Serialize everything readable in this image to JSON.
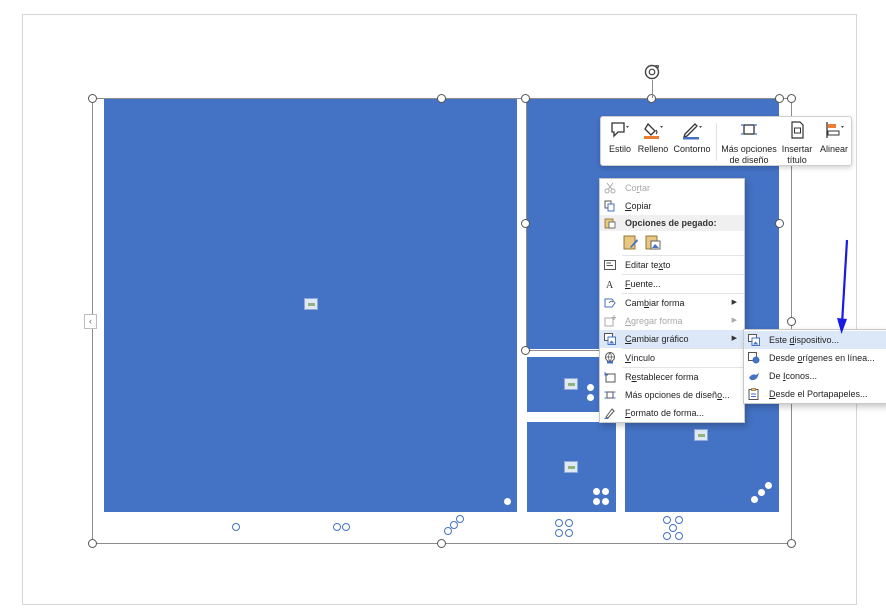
{
  "toolbar": {
    "style_label": "Estilo",
    "fill_label": "Relleno",
    "outline_label": "Contorno",
    "more_layout_line1": "Más opciones",
    "more_layout_line2": "de diseño",
    "insert_title_line1": "Insertar",
    "insert_title_line2": "título",
    "align_label": "Alinear"
  },
  "context_menu": {
    "cut": {
      "pre": "Co",
      "key": "r",
      "post": "tar"
    },
    "copy": {
      "pre": "",
      "key": "C",
      "post": "opiar"
    },
    "paste_header": "Opciones de pegado:",
    "edit_text": {
      "pre": "Editar te",
      "key": "x",
      "post": "to"
    },
    "font": {
      "pre": "",
      "key": "F",
      "post": "uente..."
    },
    "change_shape": {
      "pre": "Cam",
      "key": "b",
      "post": "iar forma"
    },
    "add_shape": {
      "pre": "",
      "key": "A",
      "post": "gregar forma"
    },
    "change_graphic": {
      "pre": "",
      "key": "C",
      "post": "ambiar gráfico"
    },
    "link": {
      "pre": "",
      "key": "V",
      "post": "ínculo"
    },
    "reset_shape": {
      "pre": "R",
      "key": "e",
      "post": "stablecer forma"
    },
    "more_layout": {
      "pre": "Más opciones de diseñ",
      "key": "o",
      "post": "..."
    },
    "format_shape": {
      "pre": "",
      "key": "F",
      "post": "ormato de forma..."
    }
  },
  "submenu": {
    "this_device": {
      "pre": "Este ",
      "key": "d",
      "post": "ispositivo..."
    },
    "online": {
      "pre": "Desde ",
      "key": "o",
      "post": "rígenes en línea..."
    },
    "icons": {
      "pre": "De ",
      "key": "I",
      "post": "conos..."
    },
    "clipboard": {
      "pre": "",
      "key": "D",
      "post": "esde el Portapapeles..."
    }
  },
  "colors": {
    "shape_fill": "#4472c4",
    "highlight": "#dce8f7",
    "annotation_arrow": "#1a1ae6"
  },
  "icons": [
    "rotate-handle-icon",
    "style-icon",
    "fill-bucket-icon",
    "outline-pen-icon",
    "layout-options-icon",
    "insert-title-icon",
    "align-icon",
    "scissors-icon",
    "copy-icon",
    "paste-icon",
    "paste-keep-icon",
    "paste-picture-icon",
    "edit-text-icon",
    "font-icon",
    "change-shape-icon",
    "add-shape-icon",
    "change-graphic-icon",
    "link-icon",
    "reset-shape-icon",
    "layout-options-icon",
    "format-shape-icon",
    "device-icon",
    "online-icon",
    "icons-bird-icon",
    "clipboard-icon",
    "image-placeholder-icon"
  ]
}
